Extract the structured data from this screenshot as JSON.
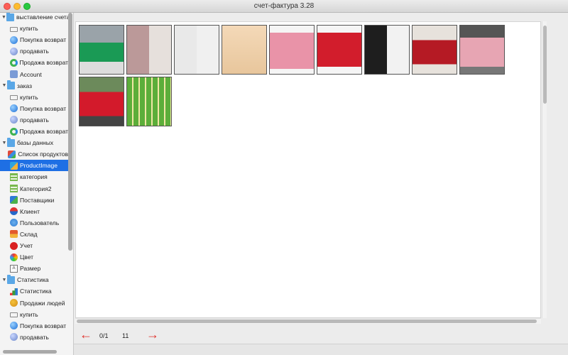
{
  "window": {
    "title": "счет-фактура 3.28"
  },
  "sidebar": {
    "items": [
      {
        "label": "выставление счета",
        "icon": "folder-icon",
        "group": true
      },
      {
        "label": "купить",
        "icon": "cart-icon"
      },
      {
        "label": "Покупка возврат",
        "icon": "globe-icon"
      },
      {
        "label": "продавать",
        "icon": "sell-icon"
      },
      {
        "label": "Продажа возврат",
        "icon": "refresh-icon"
      },
      {
        "label": "Account",
        "icon": "account-icon"
      },
      {
        "label": "заказ",
        "icon": "folder-icon",
        "group": true
      },
      {
        "label": "купить",
        "icon": "cart-icon"
      },
      {
        "label": "Покупка возврат",
        "icon": "globe-icon"
      },
      {
        "label": "продавать",
        "icon": "sell-icon"
      },
      {
        "label": "Продажа возврат",
        "icon": "refresh-icon"
      },
      {
        "label": "базы данных",
        "icon": "folder-icon",
        "group": true
      },
      {
        "label": "Список продуктов",
        "icon": "products-icon"
      },
      {
        "label": "ProductImage",
        "icon": "image-icon",
        "selected": true
      },
      {
        "label": "категория",
        "icon": "list-icon"
      },
      {
        "label": "Категория2",
        "icon": "list-icon"
      },
      {
        "label": "Поставщики",
        "icon": "suppliers-icon"
      },
      {
        "label": "Клиент",
        "icon": "client-icon"
      },
      {
        "label": "Пользователь",
        "icon": "user-icon"
      },
      {
        "label": "Склад",
        "icon": "warehouse-icon"
      },
      {
        "label": "Учет",
        "icon": "accounting-icon"
      },
      {
        "label": "Цвет",
        "icon": "color-icon"
      },
      {
        "label": "Размер",
        "icon": "size-icon"
      },
      {
        "label": "Статистика",
        "icon": "folder-icon",
        "group": true
      },
      {
        "label": "Статистика",
        "icon": "stats-icon"
      },
      {
        "label": "Продажи людей",
        "icon": "people-sales-icon"
      },
      {
        "label": "купить",
        "icon": "cart-icon"
      },
      {
        "label": "Покупка возврат",
        "icon": "globe-icon"
      },
      {
        "label": "продавать",
        "icon": "sell-icon"
      }
    ]
  },
  "gallery": {
    "images": [
      {
        "name": "green-jacket-photo"
      },
      {
        "name": "brown-sweater-photo"
      },
      {
        "name": "grey-coat-photo"
      },
      {
        "name": "lace-blouse-photo"
      },
      {
        "name": "pink-puffer-photo"
      },
      {
        "name": "red-puffer-photo"
      },
      {
        "name": "black-white-tops-photo"
      },
      {
        "name": "red-blouse-photo"
      },
      {
        "name": "pink-dress-photo"
      },
      {
        "name": "red-jacket-outdoor-photo"
      },
      {
        "name": "vegetables-chart-photo"
      }
    ]
  },
  "footer": {
    "page": "0/1",
    "count": "11",
    "prev_icon": "left-arrow-icon",
    "next_icon": "right-arrow-icon",
    "arrow_color": "#e0322b"
  },
  "colors": {
    "selection": "#1e6fe4"
  }
}
